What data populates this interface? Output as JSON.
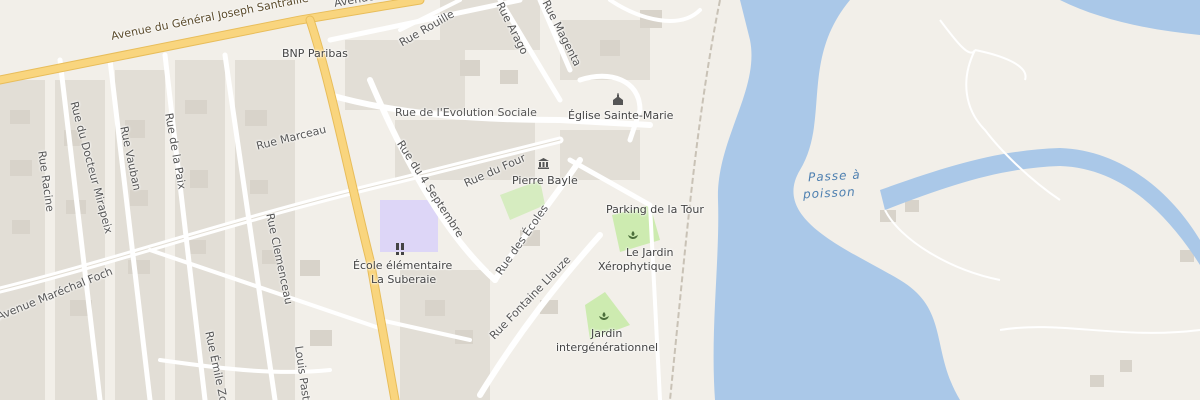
{
  "map": {
    "colors": {
      "land": "#f2efe9",
      "building": "#dcd8cf",
      "water": "#aac8e8",
      "major_road": "#f9d57e",
      "road": "#ffffff",
      "park": "#cdebb0",
      "school": "#ddd6f7"
    },
    "streets": {
      "avenue_general": "Avenue du Général Joseph Santraille",
      "avenue_top": "Avenue",
      "rue_rouille": "Rue Rouille",
      "rue_arago": "Rue Arago",
      "rue_magenta": "Rue Magenta",
      "rue_evolution": "Rue de l'Evolution Sociale",
      "rue_marceau": "Rue Marceau",
      "rue_du_four": "Rue du Four",
      "rue_4_septembre": "Rue du 4 Septembre",
      "rue_des_ecoles": "Rue des Écoles",
      "rue_fontaine": "Rue Fontaine Llauze",
      "rue_racine": "Rue Racine",
      "rue_docteur": "Rue du Docteur Mirapeix",
      "rue_vauban": "Rue Vauban",
      "rue_paix": "Rue de la Paix",
      "rue_clemenceau": "Rue Clemenceau",
      "avenue_foch": "Avenue Maréchal Foch",
      "rue_emile": "Rue Émile Zo",
      "rue_pasteur": "Louis Pasteur"
    },
    "pois": {
      "bnp": "BNP Paribas",
      "eglise": "Église Sainte-Marie",
      "pierre_bayle": "Pierre Bayle",
      "parking": "Parking de la Tour",
      "jardin_xero_1": "Le Jardin",
      "jardin_xero_2": "Xérophytique",
      "ecole_1": "École élémentaire",
      "ecole_2": "La Suberaie",
      "jardin_inter_1": "Jardin",
      "jardin_inter_2": "intergénérationnel"
    },
    "water_labels": {
      "passe_1": "Passe à",
      "passe_2": "poisson"
    },
    "icons": {
      "church": "church-icon",
      "museum": "museum-icon",
      "garden": "garden-icon",
      "school": "school-icon"
    }
  }
}
